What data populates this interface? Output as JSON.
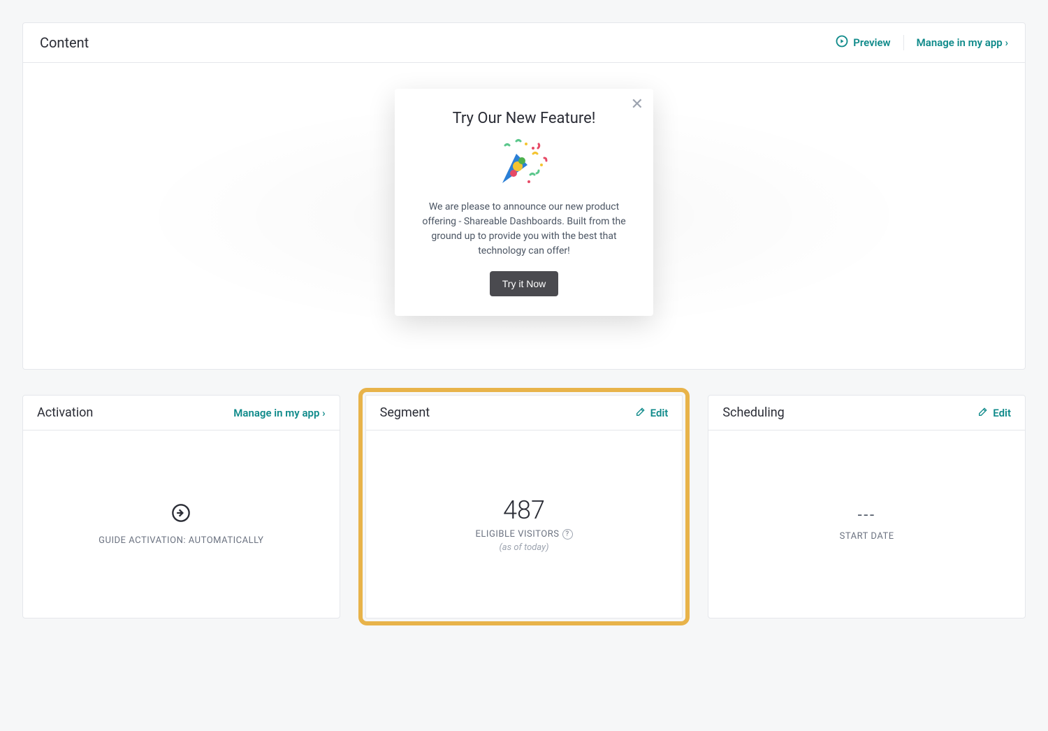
{
  "content": {
    "title": "Content",
    "preview_label": "Preview",
    "manage_label": "Manage in my app ›"
  },
  "modal": {
    "title": "Try Our New Feature!",
    "body": "We are please to announce our new product offering - Shareable Dashboards. Built from the ground up to provide you with the best that technology can offer!",
    "cta": "Try it Now"
  },
  "cards": {
    "activation": {
      "title": "Activation",
      "manage_label": "Manage in my app ›",
      "status_label": "GUIDE ACTIVATION: AUTOMATICALLY"
    },
    "segment": {
      "title": "Segment",
      "edit_label": "Edit",
      "count": "487",
      "metric": "ELIGIBLE VISITORS",
      "note": "(as of today)"
    },
    "scheduling": {
      "title": "Scheduling",
      "edit_label": "Edit",
      "value": "---",
      "label": "START DATE"
    }
  }
}
